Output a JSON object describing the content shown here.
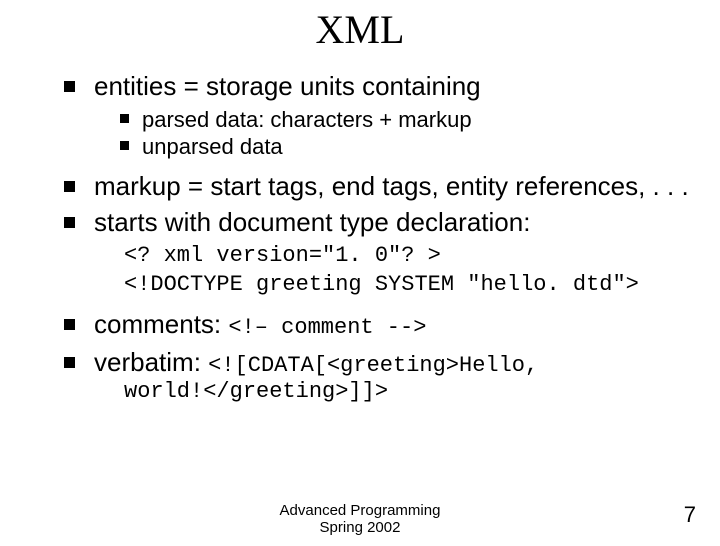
{
  "title": "XML",
  "bullets": {
    "entities": {
      "text": "entities = storage units containing",
      "sub": {
        "parsed": "parsed data: characters + markup",
        "unparsed": "unparsed data"
      }
    },
    "markup": "markup = start tags, end tags, entity references, . . .",
    "starts": "starts with document type declaration:",
    "code": {
      "line1": "<? xml version=\"1. 0\"? >",
      "line2": "<!DOCTYPE greeting SYSTEM \"hello. dtd\">"
    },
    "comments": {
      "label": "comments: ",
      "code": "<!– comment -->"
    },
    "verbatim": {
      "label": "verbatim: ",
      "code1": "<![CDATA[<greeting>Hello,",
      "code2": "world!</greeting>]]>"
    }
  },
  "footer": {
    "line1": "Advanced Programming",
    "line2": "Spring 2002"
  },
  "page": "7"
}
